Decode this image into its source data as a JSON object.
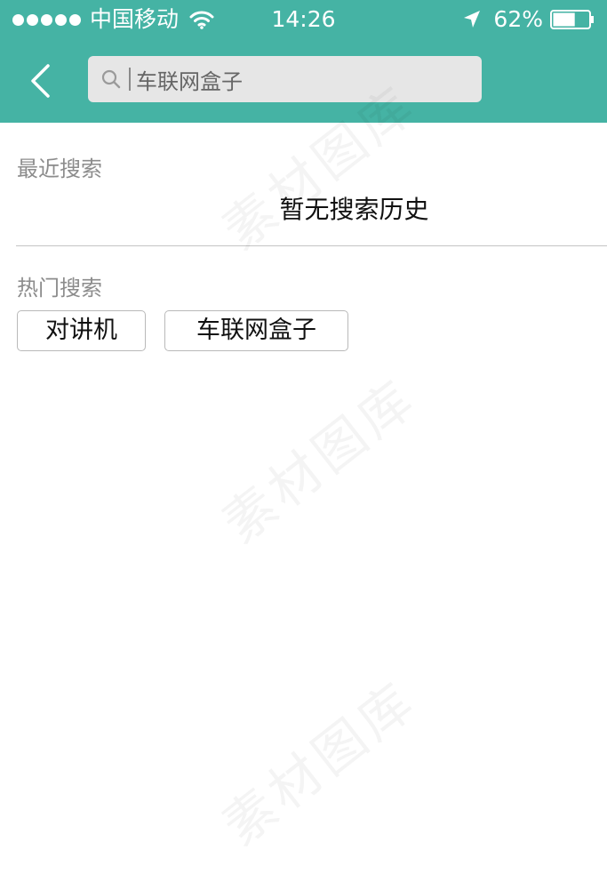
{
  "status_bar": {
    "carrier": "中国移动",
    "time": "14:26",
    "battery": "62%",
    "battery_level": 0.62,
    "icons": [
      "signal-dots",
      "wifi-icon",
      "location-icon",
      "battery-icon"
    ]
  },
  "nav": {
    "back_icon": "chevron-left-icon",
    "search": {
      "value": "车联网盒子",
      "icon": "search-icon"
    }
  },
  "recent": {
    "title": "最近搜索",
    "empty_text": "暂无搜索历史"
  },
  "hot": {
    "title": "热门搜索",
    "tags": [
      {
        "label": "对讲机"
      },
      {
        "label": "车联网盒子"
      }
    ]
  },
  "watermark": "素材图库",
  "colors": {
    "header": "#45b3a4",
    "search_bg": "#e6e6e6",
    "section_title": "#8c8c8c",
    "divider": "#c4c4c4"
  }
}
